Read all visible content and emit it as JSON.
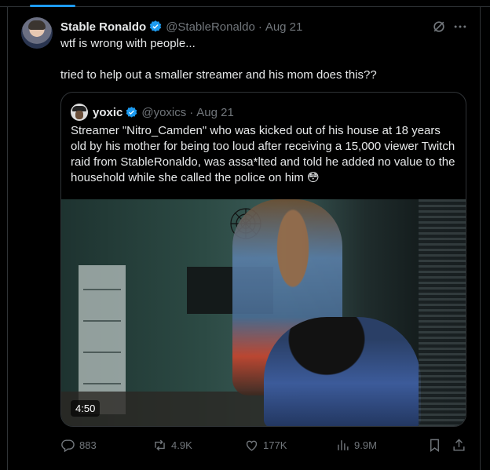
{
  "tweet": {
    "author": {
      "display_name": "Stable Ronaldo",
      "handle": "@StableRonaldo",
      "date": "Aug 21"
    },
    "text_lines": [
      "wtf is wrong with people...",
      "tried to help out a smaller streamer and his mom does this??"
    ]
  },
  "quote": {
    "author": {
      "display_name": "yoxic",
      "handle": "@yoxics",
      "date": "Aug 21"
    },
    "text": "Streamer \"Nitro_Camden\" who was kicked out of his house at 18 years old by his mother for being too loud after receiving a 15,000 viewer Twitch raid from StableRonaldo, was assa*lted and told he added no value to the household while she called the police on him 😳",
    "video": {
      "duration": "4:50"
    }
  },
  "actions": {
    "replies": "883",
    "reposts": "4.9K",
    "likes": "177K",
    "views": "9.9M"
  },
  "icons": {
    "verified": "verified-badge-icon",
    "grok": "grok-icon",
    "more": "more-dots-icon",
    "reply": "reply-icon",
    "repost": "repost-icon",
    "like": "heart-icon",
    "views": "views-icon",
    "bookmark": "bookmark-icon",
    "share": "share-icon"
  },
  "colors": {
    "accent": "#1d9bf0",
    "text": "#e7e9ea",
    "muted": "#71767b",
    "border": "#2f3336",
    "background": "#000000"
  }
}
